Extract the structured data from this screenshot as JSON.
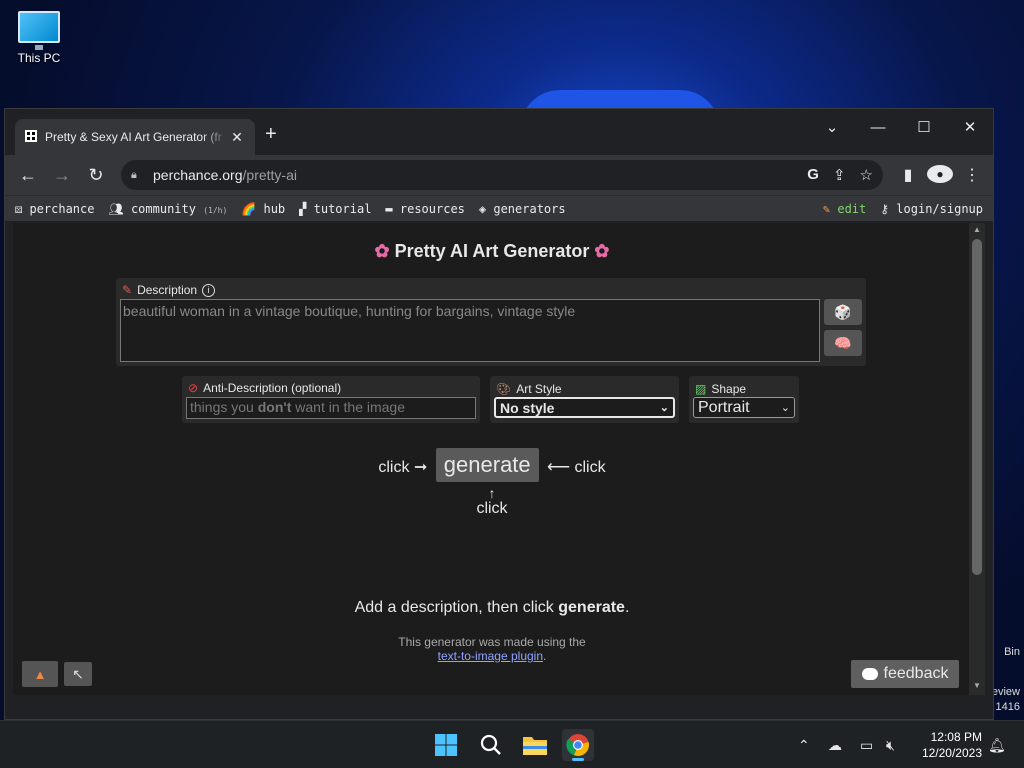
{
  "desktop": {
    "icon_label": "This PC",
    "side_text": [
      "Bin",
      "eview",
      "1416"
    ]
  },
  "browser": {
    "tab_title": "Pretty & Sexy AI Art Generator (fr",
    "url_host": "perchance.org",
    "url_path": "/pretty-ai",
    "bookmarks": [
      {
        "icon": "perchance-icon",
        "label": "perchance",
        "note": ""
      },
      {
        "icon": "community-icon",
        "label": "community",
        "note": "(1/h)"
      },
      {
        "icon": "rainbow-icon",
        "label": "hub",
        "note": ""
      },
      {
        "icon": "tutorial-icon",
        "label": "tutorial",
        "note": ""
      },
      {
        "icon": "resources-icon",
        "label": "resources",
        "note": ""
      },
      {
        "icon": "tag-icon",
        "label": "generators",
        "note": ""
      }
    ],
    "edit_label": "edit",
    "login_label": "login/signup"
  },
  "page": {
    "title": "Pretty AI Art Generator",
    "description_label": "Description",
    "description_placeholder": "beautiful woman in a vintage boutique, hunting for bargains, vintage style",
    "anti_label": "Anti-Description (optional)",
    "anti_placeholder_pre": "things you ",
    "anti_placeholder_bold": "don't",
    "anti_placeholder_post": " want in the image",
    "style_label": "Art Style",
    "style_value": "No style",
    "shape_label": "Shape",
    "shape_value": "Portrait",
    "click": "click",
    "generate": "generate",
    "hint_pre": "Add a description, then click ",
    "hint_bold": "generate",
    "hint_post": ".",
    "credit_text": "This generator was made using the",
    "credit_link": "text-to-image plugin",
    "credit_end": ".",
    "feedback": "feedback"
  },
  "taskbar": {
    "time": "12:08 PM",
    "date": "12/20/2023"
  },
  "colors": {
    "accent": "#4cc2ff",
    "link": "#8fa3ff",
    "edit": "#7fd46b"
  }
}
